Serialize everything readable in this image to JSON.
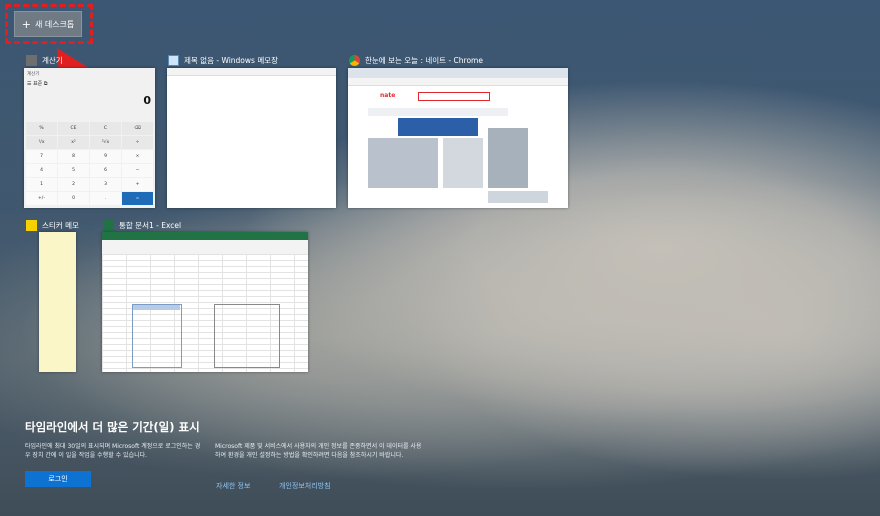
{
  "new_desktop": {
    "label": "새 데스크톱",
    "plus": "+"
  },
  "windows": [
    {
      "title": "계산기",
      "icon": "calculator-icon"
    },
    {
      "title": "제목 없음 - Windows 메모장",
      "icon": "notepad-icon"
    },
    {
      "title": "한눈에 보는 오늘 : 네이트 - Chrome",
      "icon": "chrome-icon"
    },
    {
      "title": "스티커 메모",
      "icon": "sticky-notes-icon"
    },
    {
      "title": "통합 문서1 - Excel",
      "icon": "excel-icon"
    }
  ],
  "calculator": {
    "header": "계산기",
    "mode": "☰  표준  ⧉",
    "display": "0",
    "keys": [
      "%",
      "CE",
      "C",
      "⌫",
      "¹/x",
      "x²",
      "²√x",
      "÷",
      "7",
      "8",
      "9",
      "×",
      "4",
      "5",
      "6",
      "−",
      "1",
      "2",
      "3",
      "+",
      "+/-",
      "0",
      ".",
      "="
    ]
  },
  "chrome": {
    "logo": "nate"
  },
  "timeline": {
    "heading": "타임라인에서 더 많은 기간(일) 표시",
    "body": "타임라인에 최대 30일의 표시되며 Microsoft 계정으로 로그인하는 경우 장치 간에 이 일을 작업을 수행할 수 있습니다.",
    "login_label": "로그인",
    "privacy_text": "Microsoft 제품 및 서비스에서 사용자의 개인 정보를 존중하면서 이 데이터를 사용하여 환경을 개인 설정하는 방법을 확인하려면 다음을 참조하시기 바랍니다.",
    "more_info": "자세한 정보",
    "privacy_link": "개인정보처리방침"
  },
  "colors": {
    "annotation": "#e02020",
    "excel": "#217346",
    "login": "#0e72d2"
  }
}
